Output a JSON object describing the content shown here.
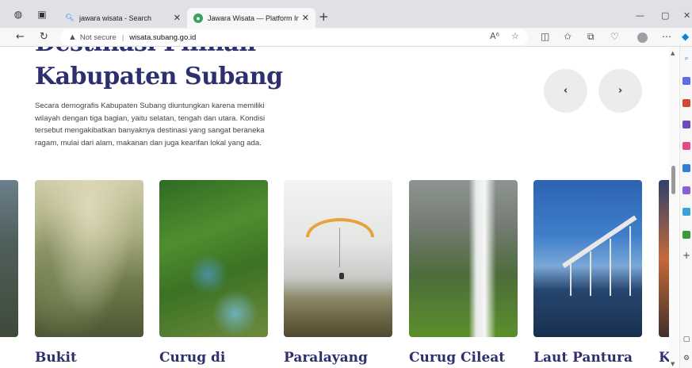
{
  "browser": {
    "tabs": [
      {
        "title": "jawara wisata - Search",
        "active": false,
        "favicon": "search-icon"
      },
      {
        "title": "Jawara Wisata — Platform Inform",
        "active": true,
        "favicon": "globe-icon"
      }
    ],
    "address": {
      "security_label": "Not secure",
      "url": "wisata.subang.go.id"
    },
    "read_aloud_label": "A⁶"
  },
  "page": {
    "heading_line1": "Destinasi Pilihan",
    "heading_line2": "Kabupaten Subang",
    "description": "Secara demografis Kabupaten Subang diuntungkan karena memiliki wilayah dengan tiga bagian, yaitu selatan, tengah dan utara. Kondisi tersebut mengakibatkan banyaknya destinasi yang sangat beraneka ragam, mulai dari alam, makanan dan juga kearifan lokal yang ada.",
    "prev_label": "‹",
    "next_label": "›",
    "cards": [
      {
        "title": "Bukit"
      },
      {
        "title": "Curug di"
      },
      {
        "title": "Paralayang"
      },
      {
        "title": "Curug Cileat"
      },
      {
        "title": "Laut Pantura"
      },
      {
        "title": "K"
      }
    ]
  },
  "colors": {
    "heading": "#2e2f6e",
    "accent_glider": "#e8a23c"
  }
}
